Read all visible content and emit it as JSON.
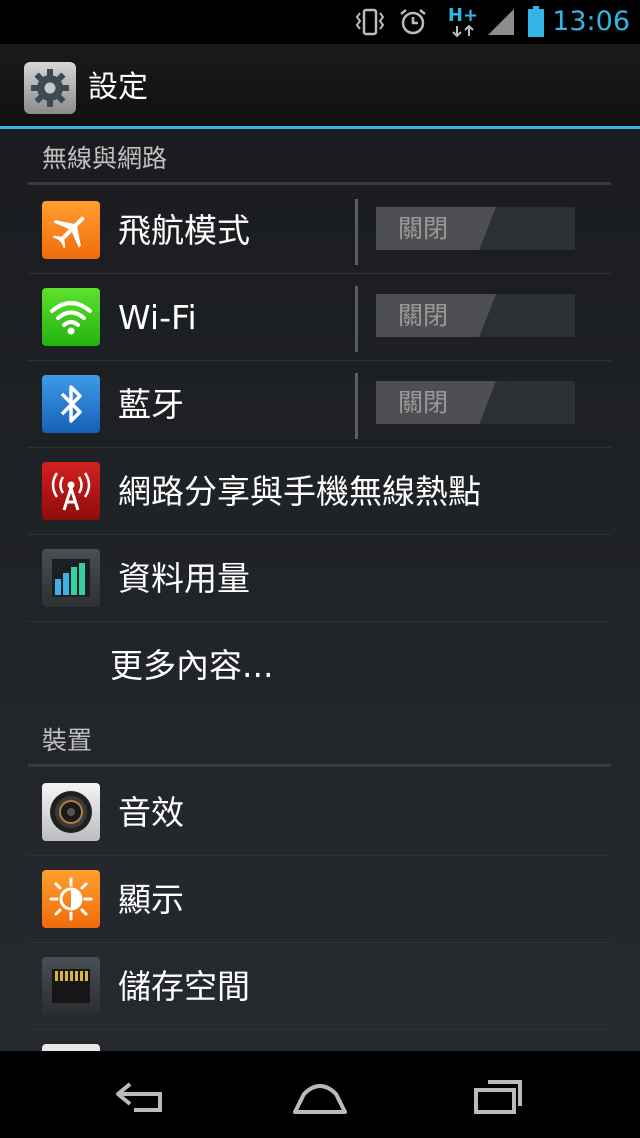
{
  "status_bar": {
    "time": "13:06",
    "network_type": "H+",
    "icons": [
      "vibrate-icon",
      "alarm-icon",
      "network-type-icon",
      "signal-icon",
      "battery-icon"
    ],
    "accent": "#33b5e5"
  },
  "action_bar": {
    "title": "設定",
    "icon": "settings-gear-icon"
  },
  "sections": {
    "wireless": {
      "header": "無線與網路",
      "items": [
        {
          "label": "飛航模式",
          "icon": "airplane-icon",
          "toggle": "關閉"
        },
        {
          "label": "Wi-Fi",
          "icon": "wifi-icon",
          "toggle": "關閉"
        },
        {
          "label": "藍牙",
          "icon": "bluetooth-icon",
          "toggle": "關閉"
        },
        {
          "label": "網路分享與手機無線熱點",
          "icon": "tethering-icon"
        },
        {
          "label": "資料用量",
          "icon": "data-usage-icon"
        },
        {
          "label": "更多內容..."
        }
      ]
    },
    "device": {
      "header": "裝置",
      "items": [
        {
          "label": "音效",
          "icon": "sound-icon"
        },
        {
          "label": "顯示",
          "icon": "display-icon"
        },
        {
          "label": "儲存空間",
          "icon": "storage-icon"
        }
      ]
    }
  },
  "nav_bar": {
    "buttons": [
      "back-icon",
      "home-icon",
      "recent-apps-icon"
    ]
  }
}
